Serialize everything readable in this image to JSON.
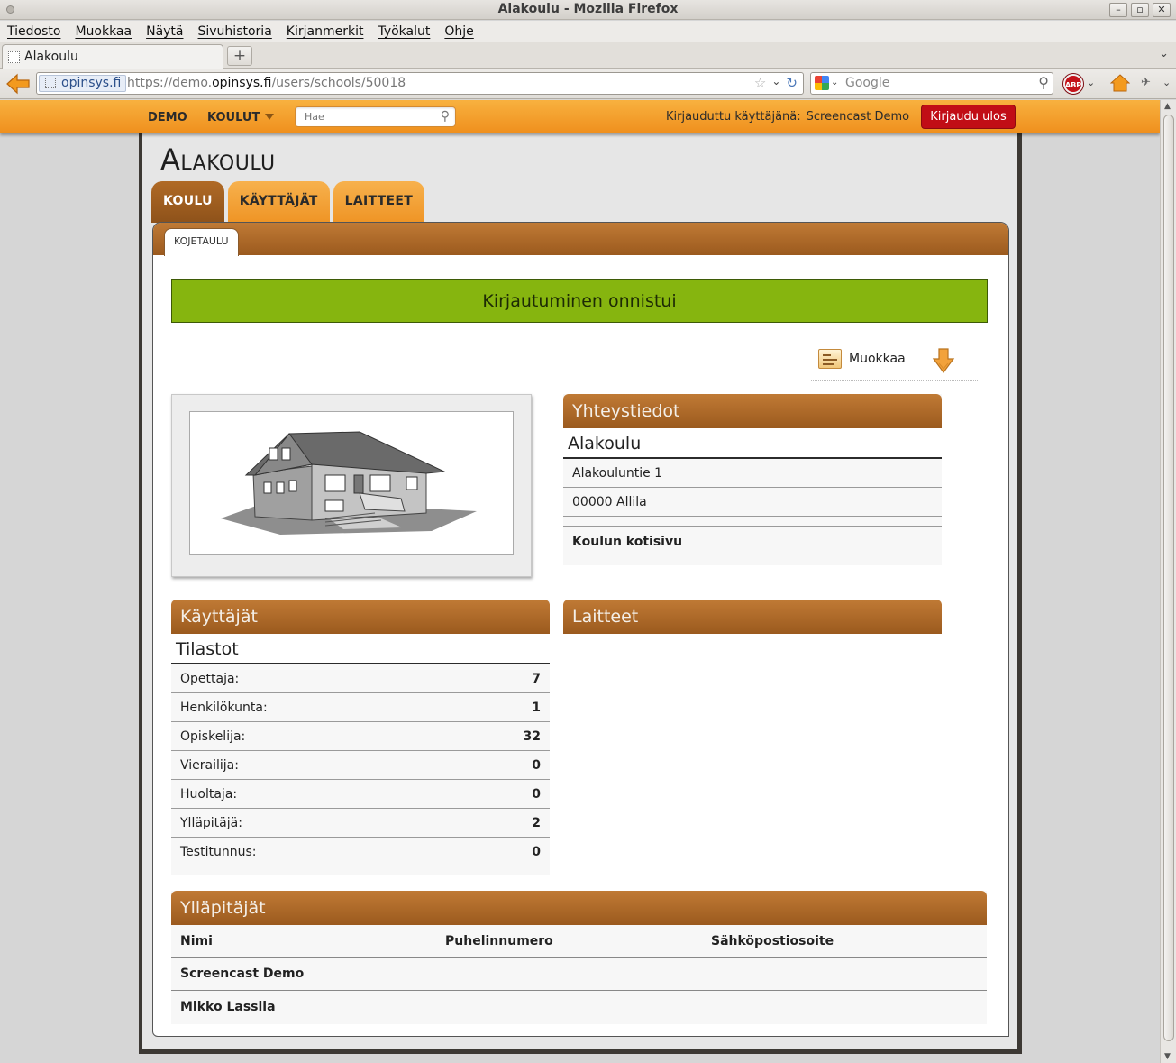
{
  "window": {
    "title": "Alakoulu - Mozilla Firefox"
  },
  "menubar": [
    "Tiedosto",
    "Muokkaa",
    "Näytä",
    "Sivuhistoria",
    "Kirjanmerkit",
    "Työkalut",
    "Ohje"
  ],
  "browser_tab": {
    "title": "Alakoulu"
  },
  "urlbar": {
    "identity": "opinsys.fi",
    "prefix": "https://demo.",
    "domain": "opinsys.fi",
    "path": "/users/schools/50018"
  },
  "searchbar": {
    "placeholder": "Google"
  },
  "icons": {
    "adblock": "ABP"
  },
  "topnav": {
    "demo": "DEMO",
    "schools": "KOULUT",
    "search_placeholder": "Hae",
    "logged_in_label": "Kirjauduttu käyttäjänä:",
    "user": "Screencast Demo",
    "logout": "Kirjaudu ulos"
  },
  "page": {
    "title": "Alakoulu",
    "tabs": [
      "KOULU",
      "KÄYTTÄJÄT",
      "LAITTEET"
    ],
    "active_tab": "KOULU",
    "subtab": "KOJETAULU",
    "success": "Kirjautuminen onnistui",
    "edit": "Muokkaa"
  },
  "contact": {
    "heading": "Yhteystiedot",
    "name": "Alakoulu",
    "street": "Alakouluntie 1",
    "city": "00000 Allila",
    "homepage": "Koulun kotisivu"
  },
  "users": {
    "heading": "Käyttäjät",
    "subheading": "Tilastot",
    "rows": [
      {
        "label": "Opettaja:",
        "value": "7"
      },
      {
        "label": "Henkilökunta:",
        "value": "1"
      },
      {
        "label": "Opiskelija:",
        "value": "32"
      },
      {
        "label": "Vierailija:",
        "value": "0"
      },
      {
        "label": "Huoltaja:",
        "value": "0"
      },
      {
        "label": "Ylläpitäjä:",
        "value": "2"
      },
      {
        "label": "Testitunnus:",
        "value": "0"
      }
    ]
  },
  "devices": {
    "heading": "Laitteet"
  },
  "admins": {
    "heading": "Ylläpitäjät",
    "columns": [
      "Nimi",
      "Puhelinnumero",
      "Sähköpostiosoite"
    ],
    "rows": [
      {
        "name": "Screencast Demo",
        "phone": "",
        "email": ""
      },
      {
        "name": "Mikko Lassila",
        "phone": "",
        "email": ""
      }
    ]
  },
  "colors": {
    "topnav": "#f5a530",
    "logout": "#c10d16",
    "success": "#86b50f",
    "header_brown": "#a9662a"
  }
}
